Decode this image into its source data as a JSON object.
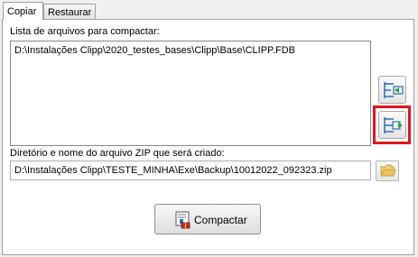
{
  "tabs": [
    {
      "label": "Copiar",
      "active": true
    },
    {
      "label": "Restaurar",
      "active": false
    }
  ],
  "files_list": {
    "label": "Lista de arquivos para compactar:",
    "items": [
      "D:\\Instalações Clipp\\2020_testes_bases\\Clipp\\Base\\CLIPP.FDB"
    ]
  },
  "side_buttons": {
    "remove_icon": "remove-files-icon",
    "add_icon": "add-files-icon"
  },
  "zip_output": {
    "label": "Diretório e nome do arquivo ZIP que será criado:",
    "value": "D:\\Instalações Clipp\\TESTE_MINHA\\Exe\\Backup\\10012022_092323.zip",
    "browse_icon": "folder-open-icon"
  },
  "action": {
    "label": "Compactar",
    "icon": "compress-icon"
  },
  "colors": {
    "highlight": "#e0161c",
    "icon_blue": "#2a6fb7",
    "icon_green": "#2e9e3a",
    "folder_yellow": "#e9c35a"
  }
}
